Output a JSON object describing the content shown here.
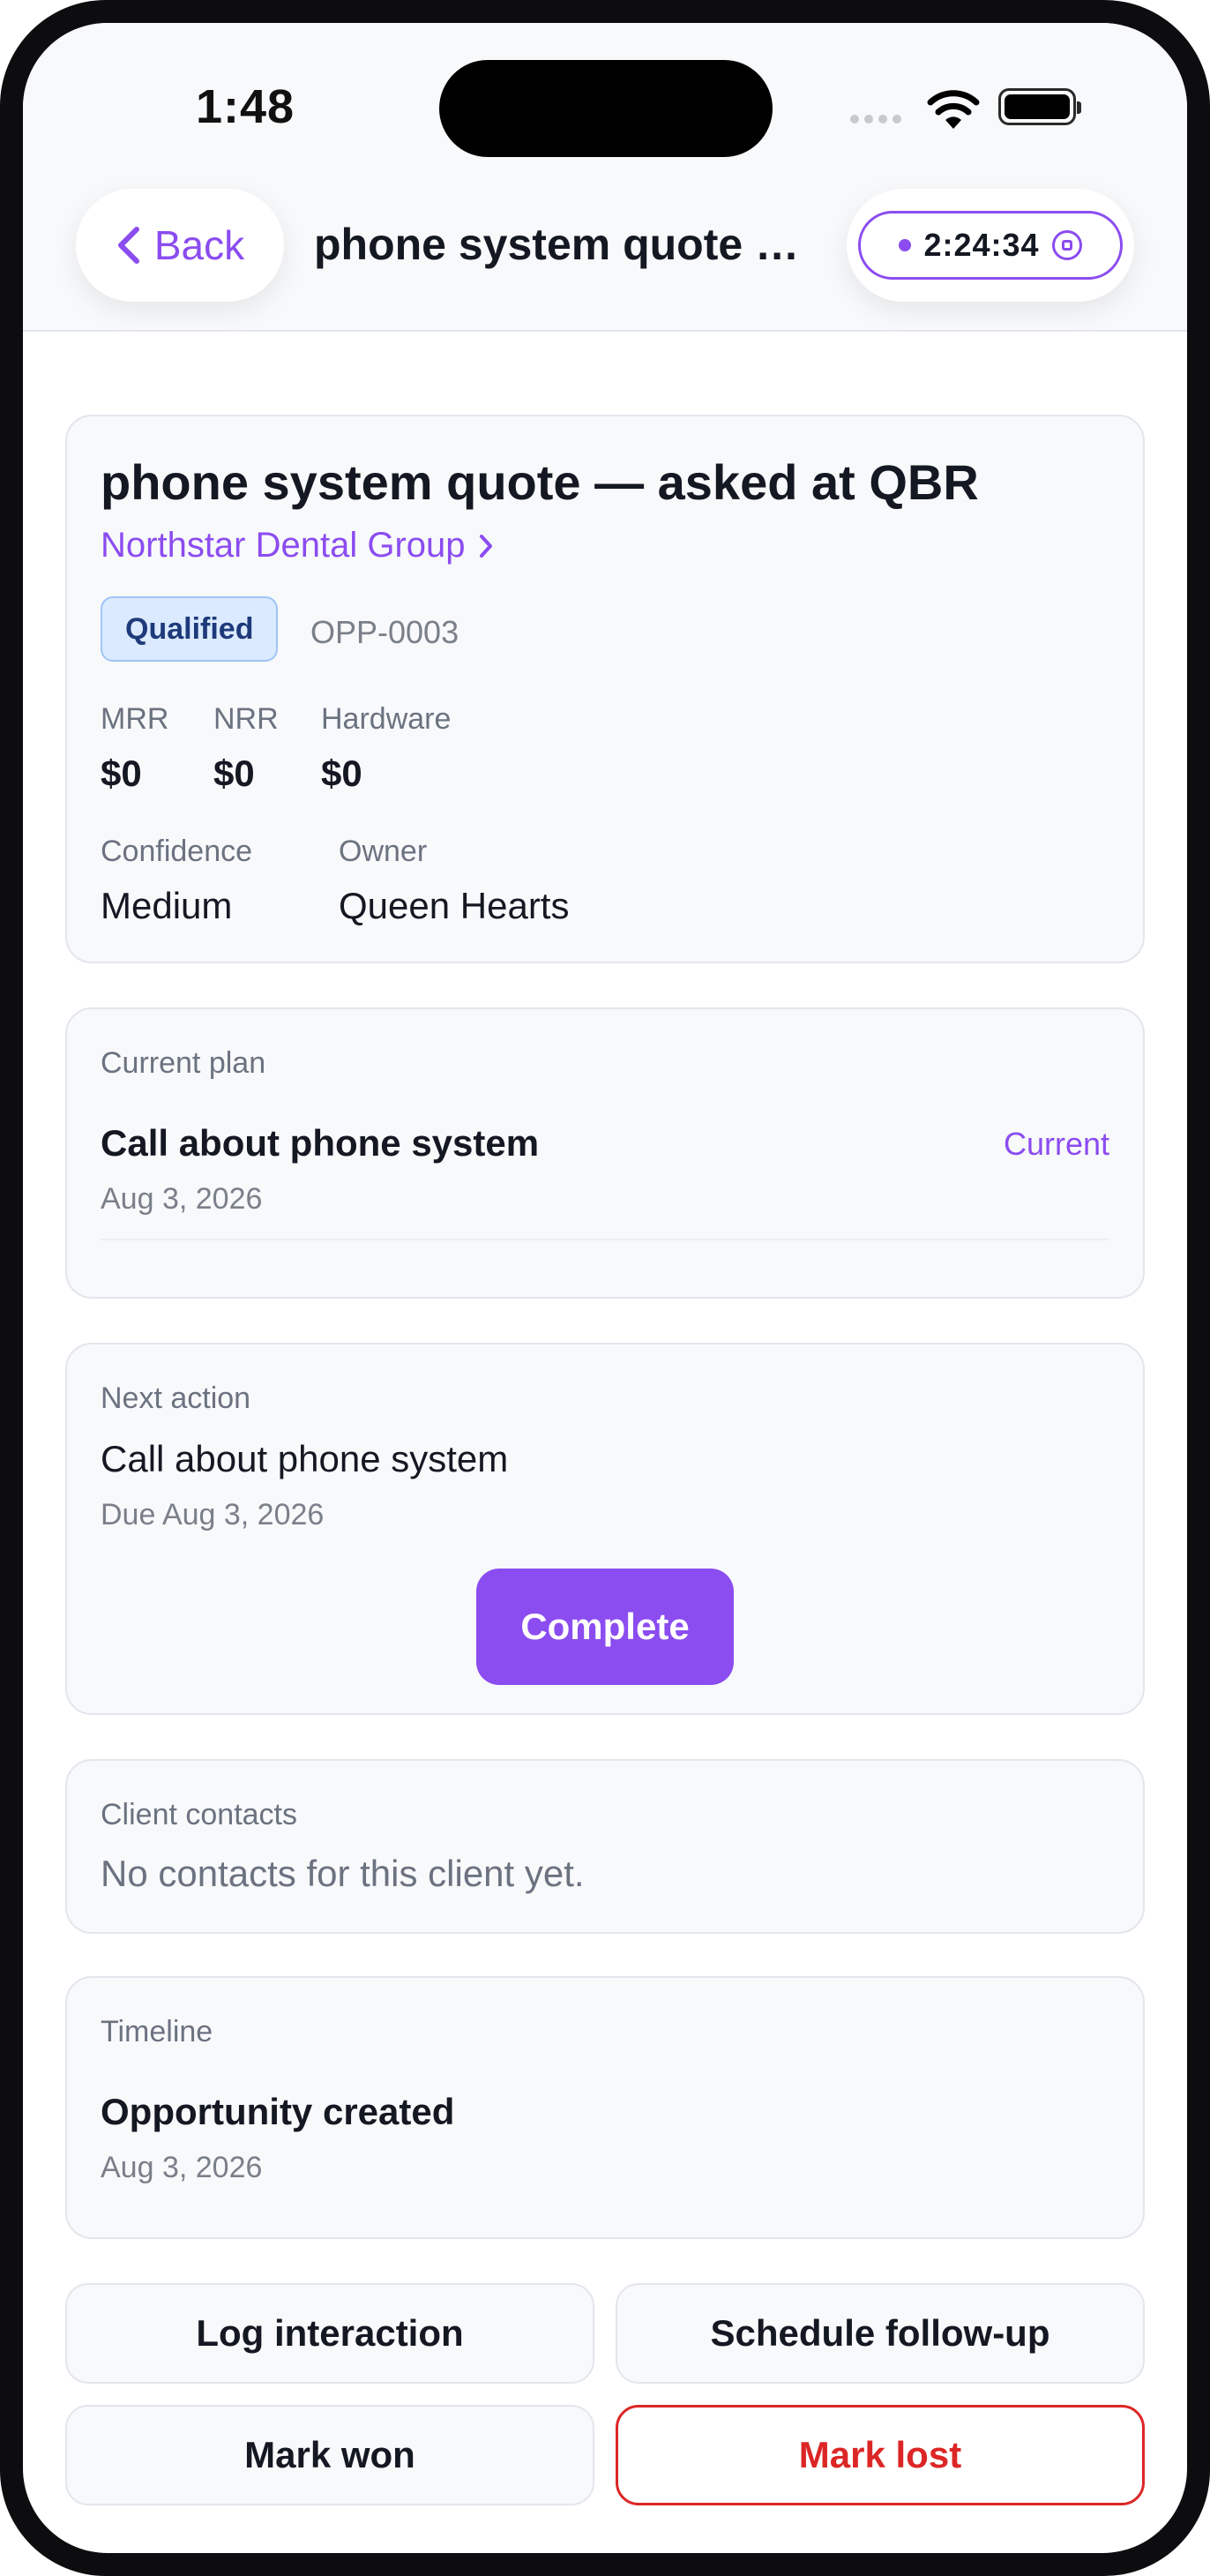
{
  "status_bar": {
    "time": "1:48"
  },
  "header": {
    "back_label": "Back",
    "title": "phone system quote — asked at QBR",
    "timer": "2:24:34"
  },
  "opportunity": {
    "title": "phone system quote — asked at QBR",
    "client": "Northstar Dental Group",
    "stage": "Qualified",
    "id": "OPP-0003",
    "metrics": [
      {
        "label": "MRR",
        "value": "$0"
      },
      {
        "label": "NRR",
        "value": "$0"
      },
      {
        "label": "Hardware",
        "value": "$0"
      }
    ],
    "confidence_label": "Confidence",
    "confidence": "Medium",
    "owner_label": "Owner",
    "owner": "Queen Hearts"
  },
  "current_plan": {
    "label": "Current plan",
    "title": "Call about phone system",
    "date": "Aug 3, 2026",
    "tag": "Current"
  },
  "next_action": {
    "label": "Next action",
    "title": "Call about phone system",
    "due": "Due Aug 3, 2026",
    "button": "Complete"
  },
  "client_contacts": {
    "label": "Client contacts",
    "empty": "No contacts for this client yet."
  },
  "timeline": {
    "label": "Timeline",
    "event": "Opportunity created",
    "date": "Aug 3, 2026"
  },
  "actions": {
    "log": "Log interaction",
    "schedule": "Schedule follow-up",
    "won": "Mark won",
    "lost": "Mark lost"
  },
  "colors": {
    "accent": "#8b4cf0",
    "danger": "#dc2626",
    "badge_bg": "#dbeafe"
  }
}
